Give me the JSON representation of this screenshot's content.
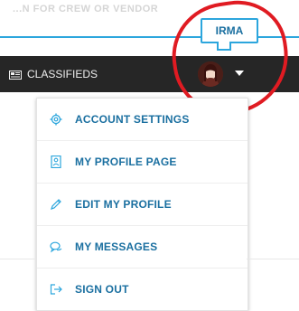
{
  "search": {
    "placeholder_text": "...N FOR CREW OR VENDOR"
  },
  "nav": {
    "classifieds_label": "CLASSIFIEDS"
  },
  "user": {
    "tooltip_name": "IRMA"
  },
  "menu": {
    "items": [
      {
        "label": "ACCOUNT SETTINGS",
        "icon": "gear-icon"
      },
      {
        "label": "MY PROFILE PAGE",
        "icon": "profile-card-icon"
      },
      {
        "label": "EDIT MY PROFILE",
        "icon": "pencil-icon"
      },
      {
        "label": "MY MESSAGES",
        "icon": "chat-bubbles-icon"
      },
      {
        "label": "SIGN OUT",
        "icon": "sign-out-icon"
      }
    ]
  },
  "colors": {
    "accent": "#2ca6dd",
    "link": "#1a6fa0",
    "navbar": "#262626",
    "annotation": "#e01b22"
  }
}
